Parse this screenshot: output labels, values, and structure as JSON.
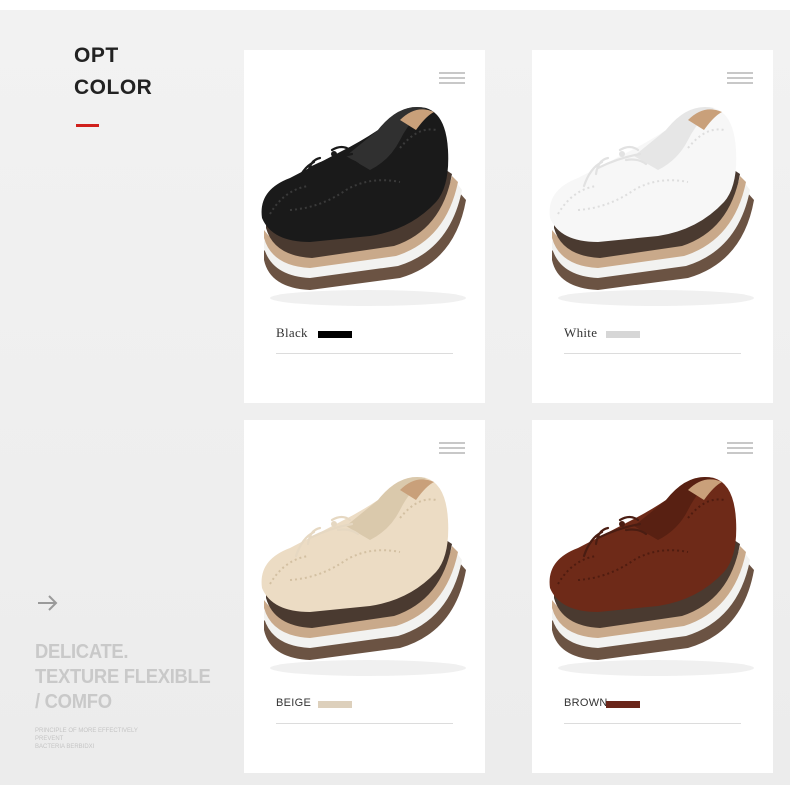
{
  "heading": {
    "line1": "OPT",
    "line2": "COLOR"
  },
  "accent_color": "#d0201c",
  "arrow_icon": "right-arrow-icon",
  "tagline": {
    "line1": "DELICATE.",
    "line2": "TEXTURE FLEXIBLE",
    "line3": "/ COMFO",
    "fine_print_1": "PRINCIPLE OF MORE EFFECTIVELY PREVENT",
    "fine_print_2": "BACTERIA BERBIDXI"
  },
  "cards": [
    {
      "label": "Black",
      "swatch": "#000000",
      "shoe_color": "#1a1a1a",
      "shoe_shade": "#3a3a3a",
      "lace": "#1a1a1a"
    },
    {
      "label": "White",
      "swatch": "#d6d6d6",
      "shoe_color": "#f7f7f7",
      "shoe_shade": "#dedede",
      "lace": "#e2e2e2"
    },
    {
      "label": "BEIGE",
      "swatch": "#ddd0bc",
      "shoe_color": "#ecdcc4",
      "shoe_shade": "#d3c0a2",
      "lace": "#e6d8c2"
    },
    {
      "label": "BROWN",
      "swatch": "#6a2519",
      "shoe_color": "#6e2a18",
      "shoe_shade": "#4f1c10",
      "lace": "#4a1d12"
    }
  ]
}
